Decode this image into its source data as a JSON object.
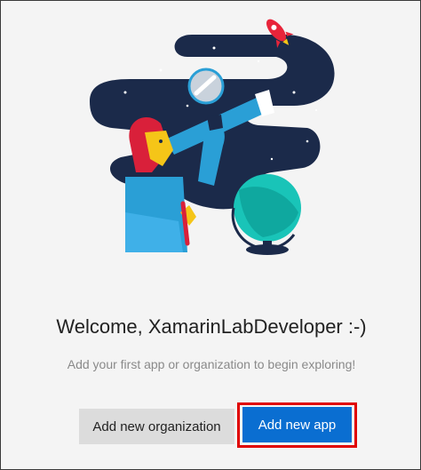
{
  "welcome": {
    "title": "Welcome, XamarinLabDeveloper :-)",
    "subtitle": "Add your first app or organization to begin exploring!"
  },
  "actions": {
    "add_org_label": "Add new organization",
    "add_app_label": "Add new app"
  },
  "colors": {
    "primary": "#0a6ed1",
    "highlight": "#e00000",
    "secondary_bg": "#dcdcdc",
    "night_sky": "#1b2a4a"
  }
}
